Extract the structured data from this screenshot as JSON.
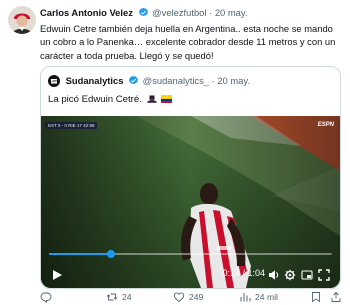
{
  "author": {
    "name": "Carlos Antonio Velez",
    "handle": "@velezfutbol",
    "separator": "·",
    "date": "20 may."
  },
  "tweet_text": "Edwuin Cetre también deja huella en Argentina.. esta noche se mando un cobro a lo Panenka… excelente cobrador desde 11 metros y con un carácter a toda prueba. Llegó y se quedó!",
  "quoted": {
    "name": "Sudanalytics",
    "handle": "@sudanalytics_",
    "separator": "·",
    "date": "20 may.",
    "text": "La picó Edwuin Cetré.",
    "scorebug": "EST  0 - 0  RIE   17  42:58",
    "broadcaster": "ESPN"
  },
  "video": {
    "progress_fraction": 0.22,
    "time_display": "0:14 / 1:04"
  },
  "actions": {
    "replies": "",
    "retweets": "24",
    "likes": "249",
    "views": "24 mil"
  },
  "colors": {
    "accent": "#1d9bf0",
    "text": "#0f1419",
    "muted": "#536471",
    "border": "#cfd9de"
  },
  "icons": {
    "verified": "verified-badge-icon",
    "reply": "reply-icon",
    "retweet": "retweet-icon",
    "like": "heart-icon",
    "views": "views-icon",
    "bookmark": "bookmark-icon",
    "share": "share-icon"
  }
}
